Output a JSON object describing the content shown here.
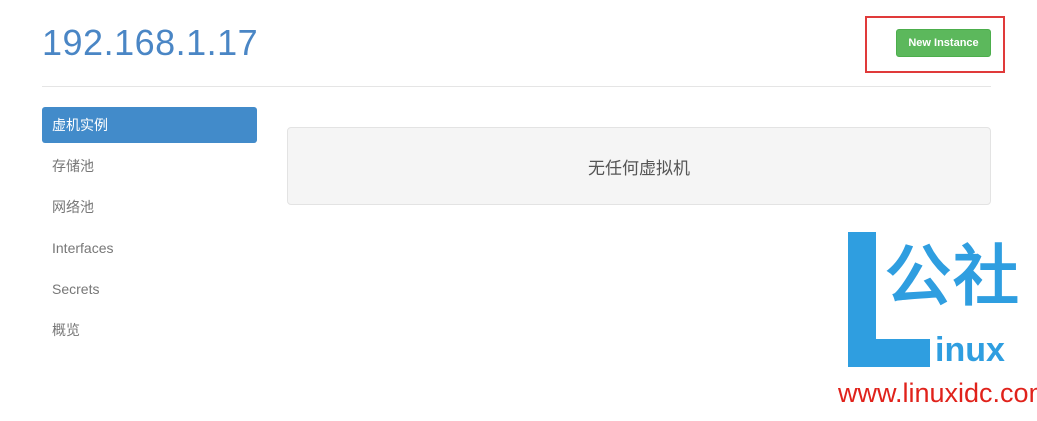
{
  "header": {
    "host": "192.168.1.17",
    "new_instance_label": "New Instance"
  },
  "sidebar": {
    "items": [
      {
        "label": "虚机实例"
      },
      {
        "label": "存储池"
      },
      {
        "label": "网络池"
      },
      {
        "label": "Interfaces"
      },
      {
        "label": "Secrets"
      },
      {
        "label": "概览"
      }
    ]
  },
  "main": {
    "empty_message": "无任何虚拟机"
  },
  "watermark": {
    "cn": "公社",
    "linux": "inux",
    "url": "www.linuxidc.com"
  },
  "colors": {
    "accent_blue": "#428bca",
    "title_blue": "#4a86c5",
    "success_green": "#5cb85c",
    "highlight_red": "#e03a3a",
    "watermark_blue": "#2f9ee0"
  }
}
